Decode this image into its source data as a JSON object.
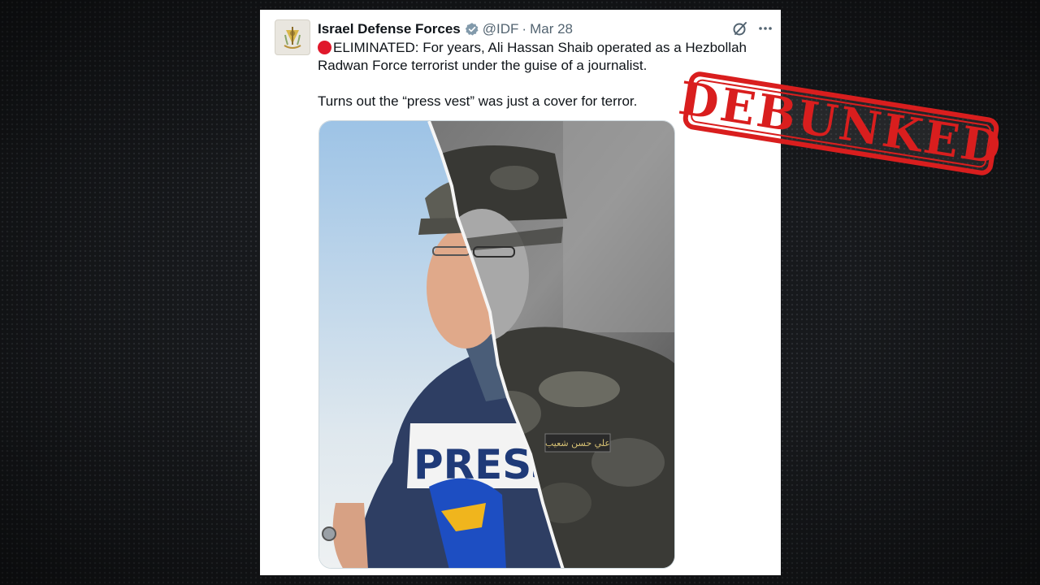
{
  "tweet": {
    "author_name": "Israel Defense Forces",
    "handle": "@IDF",
    "separator": "·",
    "date": "Mar 28",
    "text_line1": "ELIMINATED: For years, Ali Hassan Shaib operated as a Hezbollah Radwan Force terrorist under the guise of a journalist.",
    "text_line2": "Turns out the “press vest” was just a cover for terror.",
    "image": {
      "vest_text": "PRESS",
      "name_patch": "علي حسن شعيب"
    }
  },
  "stamp": {
    "text": "DEBUNKED",
    "color": "#d91e1e"
  },
  "icons": {
    "verified": "verified-badge-icon",
    "grok": "grok-icon",
    "more": "more-options-icon",
    "live": "red-circle-icon"
  },
  "colors": {
    "verified": "#829aab",
    "text": "#0f1419",
    "secondary": "#536471",
    "red_dot": "#e0182b"
  }
}
